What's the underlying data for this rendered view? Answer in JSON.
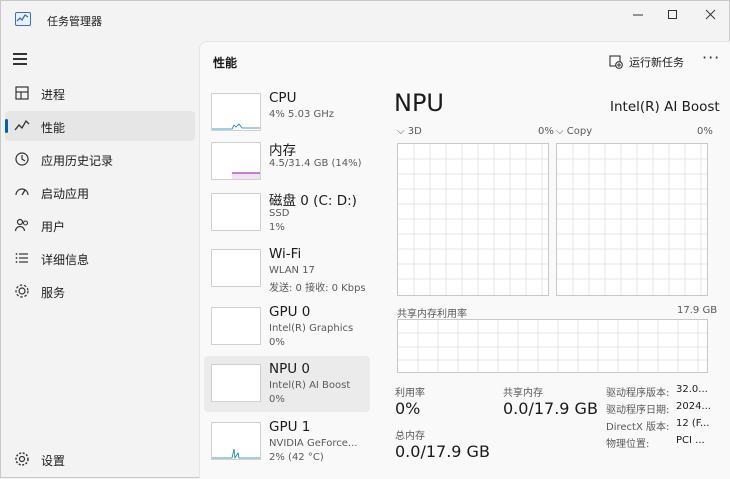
{
  "window": {
    "title": "任务管理器"
  },
  "sidebar": {
    "items": [
      {
        "label": "进程",
        "icon": "processes-icon"
      },
      {
        "label": "性能",
        "icon": "performance-icon"
      },
      {
        "label": "应用历史记录",
        "icon": "app-history-icon"
      },
      {
        "label": "启动应用",
        "icon": "startup-icon"
      },
      {
        "label": "用户",
        "icon": "users-icon"
      },
      {
        "label": "详细信息",
        "icon": "details-icon"
      },
      {
        "label": "服务",
        "icon": "services-icon"
      }
    ],
    "settings_label": "设置"
  },
  "header": {
    "title": "性能",
    "run_task_label": "运行新任务",
    "more_label": "···"
  },
  "devices": [
    {
      "name": "CPU",
      "sub1": "4% 5.03 GHz",
      "sub2": "",
      "sub3": ""
    },
    {
      "name": "内存",
      "sub1": "4.5/31.4 GB (14%)",
      "sub2": "",
      "sub3": ""
    },
    {
      "name": "磁盘 0 (C: D:)",
      "sub1": "SSD",
      "sub2": "1%",
      "sub3": ""
    },
    {
      "name": "Wi-Fi",
      "sub1": "WLAN 17",
      "sub2": "发送: 0 接收: 0 Kbps",
      "sub3": ""
    },
    {
      "name": "GPU 0",
      "sub1": "Intel(R) Graphics",
      "sub2": "0%",
      "sub3": ""
    },
    {
      "name": "NPU 0",
      "sub1": "Intel(R) AI Boost",
      "sub2": "0%",
      "sub3": ""
    },
    {
      "name": "GPU 1",
      "sub1": "NVIDIA GeForce...",
      "sub2": "2% (42 °C)",
      "sub3": ""
    }
  ],
  "detail": {
    "title": "NPU",
    "device": "Intel(R) AI Boost",
    "graph_3d_label": "3D",
    "graph_3d_value": "0%",
    "graph_copy_label": "Copy",
    "graph_copy_value": "0%",
    "shared_mem_label": "共享内存利用率",
    "shared_mem_max": "17.9 GB",
    "stats": {
      "util_label": "利用率",
      "util_value": "0%",
      "shared_label": "共享内存",
      "shared_value": "0.0/17.9 GB",
      "total_label": "总内存",
      "total_value": "0.0/17.9 GB"
    },
    "props": [
      {
        "label": "驱动程序版本:",
        "value": "32.0..."
      },
      {
        "label": "驱动程序日期:",
        "value": "2024..."
      },
      {
        "label": "DirectX 版本:",
        "value": "12 (F..."
      },
      {
        "label": "物理位置:",
        "value": "PCI ..."
      }
    ]
  },
  "colors": {
    "accent": "#005fb8",
    "cpu": "#117dbb",
    "memory": "#8b12ae",
    "gpu": "#0d7e9c"
  }
}
